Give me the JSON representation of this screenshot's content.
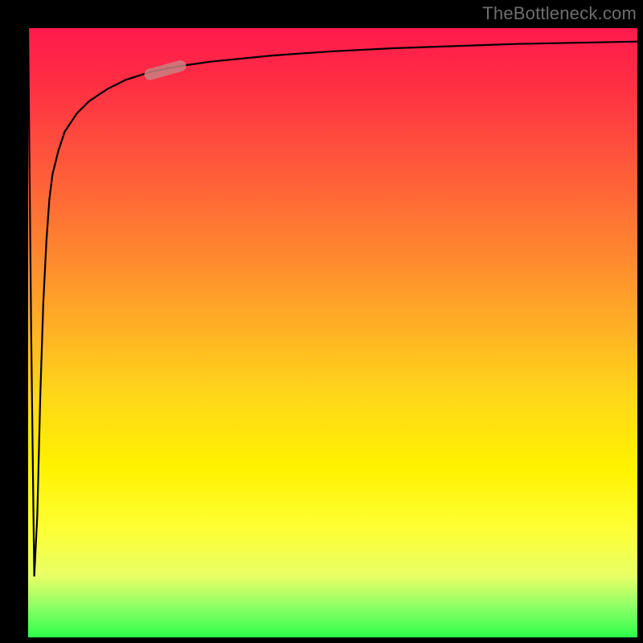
{
  "attribution": "TheBottleneck.com",
  "colors": {
    "background": "#000000",
    "gradient_top": "#ff1a4d",
    "gradient_bottom": "#2cff4a",
    "curve": "#000000",
    "marker": "#c98080"
  },
  "chart_data": {
    "type": "line",
    "xlabel": "",
    "ylabel": "",
    "xlim": [
      0,
      100
    ],
    "ylim": [
      0,
      100
    ],
    "grid": false,
    "legend": false,
    "annotations": [],
    "series": [
      {
        "name": "curve",
        "x": [
          0,
          0.5,
          1,
          1.5,
          2,
          2.5,
          3,
          3.5,
          4,
          5,
          6,
          8,
          10,
          13,
          16,
          20,
          25,
          30,
          40,
          50,
          60,
          80,
          100
        ],
        "y": [
          100,
          50,
          10,
          20,
          40,
          55,
          65,
          72,
          76,
          80,
          83,
          86,
          88,
          90,
          91.5,
          92.8,
          93.8,
          94.5,
          95.5,
          96.2,
          96.7,
          97.4,
          97.8
        ]
      }
    ],
    "marker": {
      "x_range": [
        20,
        25
      ],
      "y_range": [
        92.4,
        93.8
      ],
      "shape": "capsule"
    }
  }
}
